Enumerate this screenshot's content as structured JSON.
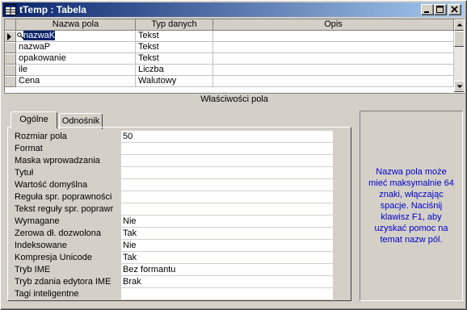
{
  "window": {
    "title": "tTemp : Tabela",
    "titlebar_gradient_start": "#0a246a",
    "titlebar_gradient_end": "#a6caf0",
    "buttons": [
      "minimize-icon",
      "maximize-icon",
      "close-icon"
    ]
  },
  "design_grid": {
    "headers": {
      "field_name": "Nazwa pola",
      "data_type": "Typ danych",
      "description": "Opis"
    },
    "rows": [
      {
        "field_name": "nazwaK",
        "data_type": "Tekst",
        "description": "",
        "current": true,
        "primary_key": true
      },
      {
        "field_name": "nazwaP",
        "data_type": "Tekst",
        "description": ""
      },
      {
        "field_name": "opakowanie",
        "data_type": "Tekst",
        "description": ""
      },
      {
        "field_name": "ile",
        "data_type": "Liczba",
        "description": ""
      },
      {
        "field_name": "Cena",
        "data_type": "Walutowy",
        "description": ""
      }
    ]
  },
  "properties": {
    "header": "Właściwości pola",
    "tabs": [
      {
        "label": "Ogólne",
        "active": true
      },
      {
        "label": "Odnośnik",
        "active": false
      }
    ],
    "rows": [
      {
        "label": "Rozmiar pola",
        "value": "50"
      },
      {
        "label": "Format",
        "value": ""
      },
      {
        "label": "Maska wprowadzania",
        "value": ""
      },
      {
        "label": "Tytuł",
        "value": ""
      },
      {
        "label": "Wartość domyślna",
        "value": ""
      },
      {
        "label": "Reguła spr. poprawności",
        "value": ""
      },
      {
        "label": "Tekst reguły spr. poprawr",
        "value": ""
      },
      {
        "label": "Wymagane",
        "value": "Nie"
      },
      {
        "label": "Zerowa dł. dozwolona",
        "value": "Tak"
      },
      {
        "label": "Indeksowane",
        "value": "Nie"
      },
      {
        "label": "Kompresja Unicode",
        "value": "Tak"
      },
      {
        "label": "Tryb IME",
        "value": "Bez formantu"
      },
      {
        "label": "Tryb zdania edytora IME",
        "value": "Brak"
      },
      {
        "label": "Tagi inteligentne",
        "value": ""
      }
    ],
    "help_text": "Nazwa pola może mieć maksymalnie 64 znaki, włączając spacje. Naciśnij klawisz F1, aby uzyskać pomoc na temat nazw pól.",
    "help_color": "#0000c8"
  }
}
